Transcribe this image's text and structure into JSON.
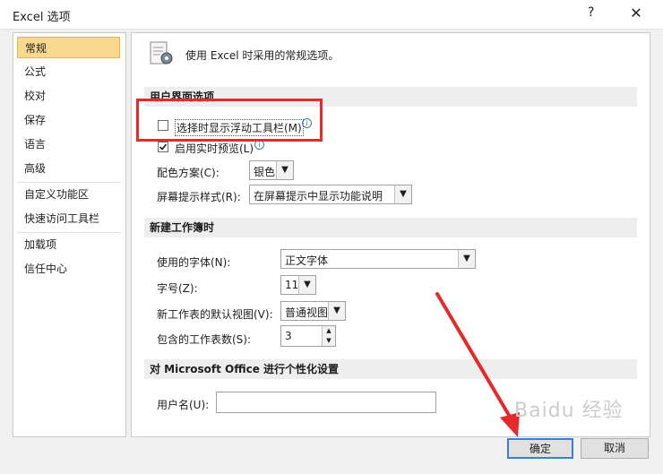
{
  "window": {
    "title": "Excel 选项",
    "help": "?",
    "close": "✕"
  },
  "nav": [
    {
      "label": "常规",
      "selected": true
    },
    {
      "label": "公式"
    },
    {
      "label": "校对"
    },
    {
      "label": "保存"
    },
    {
      "label": "语言"
    },
    {
      "label": "高级"
    },
    {
      "label": "自定义功能区"
    },
    {
      "label": "快速访问工具栏"
    },
    {
      "label": "加载项"
    },
    {
      "label": "信任中心"
    }
  ],
  "main": {
    "intro": "使用 Excel 时采用的常规选项。",
    "ui_section": {
      "title": "用户界面选项",
      "floating_toolbar": {
        "label": "选择时显示浮动工具栏(M)",
        "checked": false
      },
      "live_preview": {
        "label": "启用实时预览(L)",
        "checked": true
      },
      "color_scheme": {
        "label": "配色方案(C):",
        "value": "银色"
      },
      "screentip": {
        "label": "屏幕提示样式(R):",
        "value": "在屏幕提示中显示功能说明"
      }
    },
    "new_workbook": {
      "title": "新建工作簿时",
      "font": {
        "label": "使用的字体(N):",
        "value": "正文字体"
      },
      "size": {
        "label": "字号(Z):",
        "value": "11"
      },
      "view": {
        "label": "新工作表的默认视图(V):",
        "value": "普通视图"
      },
      "sheets": {
        "label": "包含的工作表数(S):",
        "value": "3"
      }
    },
    "personalize": {
      "title": "对 Microsoft Office 进行个性化设置",
      "username": {
        "label": "用户名(U):",
        "value": ""
      }
    }
  },
  "buttons": {
    "ok": "确定",
    "cancel": "取消"
  },
  "watermark": "Baidu 经验",
  "colors": {
    "highlight": "#e42a2a",
    "nav_selected": "#f9d98e"
  }
}
